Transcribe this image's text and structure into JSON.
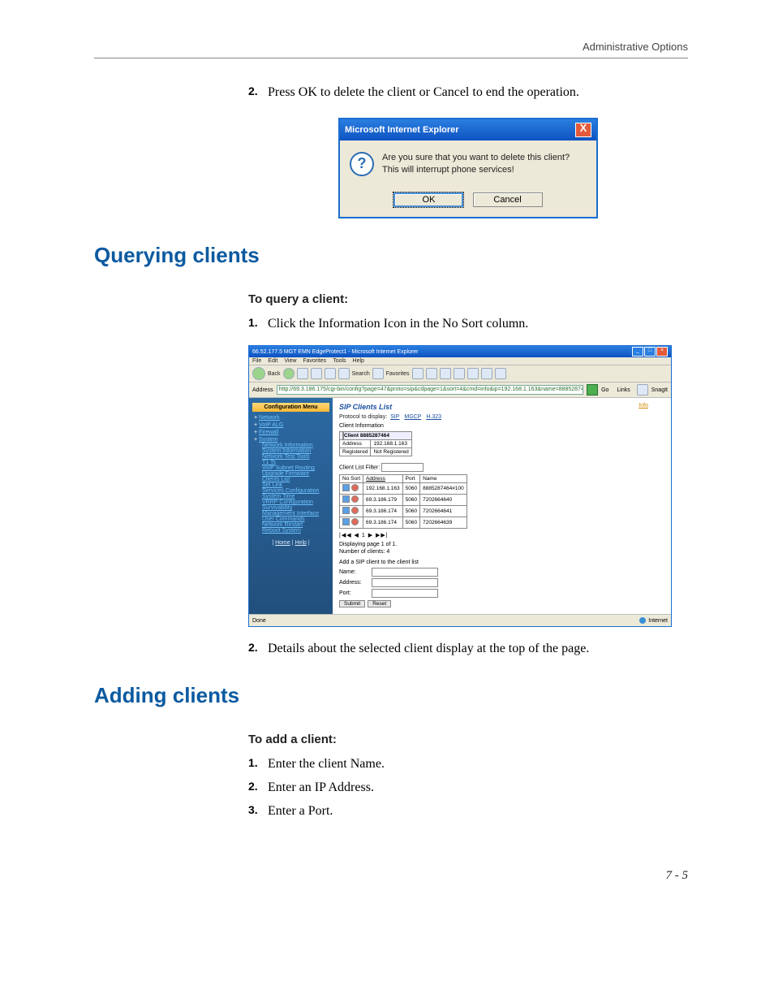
{
  "header": {
    "running": "Administrative Options"
  },
  "step2_top": {
    "num": "2.",
    "text": "Press OK to delete the client or Cancel to end the operation."
  },
  "dialog": {
    "title": "Microsoft Internet Explorer",
    "close": "X",
    "q": "?",
    "line1": "Are you sure that you want to delete this client?",
    "line2": "This will interrupt phone services!",
    "ok": "OK",
    "cancel": "Cancel"
  },
  "sec_query": {
    "title": "Querying clients",
    "sub": "To query a client:"
  },
  "q_step1": {
    "num": "1.",
    "text": "Click the Information Icon in the No Sort column."
  },
  "browser": {
    "title": "66.52.177.5 MGT EMN EdgeProtect1 - Microsoft Internet Explorer",
    "menu": {
      "file": "File",
      "edit": "Edit",
      "view": "View",
      "fav": "Favorites",
      "tools": "Tools",
      "help": "Help"
    },
    "tool": {
      "back": "Back",
      "search": "Search",
      "fav": "Favorites"
    },
    "addr_lbl": "Address",
    "addr_url": "http://69.3.186.175/cgi-bin/config?page=47&proto=sip&cdpage=1&sort=4&cmd=info&ip=192.168.1.163&name=8885287464#100",
    "go": "Go",
    "links": "Links",
    "snag": "SnagIt",
    "side_head": "Configuration Menu",
    "side": {
      "net": "Network",
      "voip": "VoIP ALG",
      "fire": "Firewall",
      "sys": "System",
      "ni": "Network Information",
      "si": "System Information",
      "nt": "Network Test Tools",
      "tos": "T1 Ts",
      "sr": "VoIP Subnet Routing",
      "uf": "Upgrade Firmware",
      "cl": "Clients List",
      "sl": "Set Link",
      "sc": "Services Configuration",
      "st": "System Time",
      "vr": "VRRP Configuration",
      "sv": "Survivability",
      "mi": "Management Interface",
      "uc": "User Commands",
      "nr": "Network Restart",
      "rs": "Reboot System",
      "home": "Home",
      "help": "Help"
    },
    "main": {
      "title": "SIP Clients List",
      "info": "Info",
      "proto_lbl": "Protocol to display:",
      "proto_sip": "SIP",
      "proto_mgcp": "MGCP",
      "proto_h323": "H.323",
      "ci_hdr": "Client Information",
      "ci_name": "Client 8885287464",
      "ci_addr_lbl": "Address",
      "ci_addr": "192.168.1.163",
      "ci_reg_lbl": "Registered",
      "ci_reg": "Not Registered",
      "filter_lbl": "Client List Filter:",
      "cols": {
        "nosort": "No Sort",
        "addr": "Address",
        "port": "Port",
        "name": "Name"
      },
      "rows": [
        {
          "addr": "192.168.1.163",
          "port": "5060",
          "name": "8885287464#100"
        },
        {
          "addr": "69.3.186.179",
          "port": "5060",
          "name": "7202664640"
        },
        {
          "addr": "69.3.186.174",
          "port": "5060",
          "name": "7202664641"
        },
        {
          "addr": "69.3.186.174",
          "port": "5060",
          "name": "7202664639"
        }
      ],
      "pager": "|◀◀ ◀  1   ▶ ▶▶|",
      "disp": "Displaying page 1 of 1.",
      "count": "Number of clients: 4",
      "add_hdr": "Add a SIP client to the client list",
      "name_lbl": "Name:",
      "addr_lbl": "Address:",
      "port_lbl": "Port:",
      "submit": "Submit",
      "reset": "Reset"
    },
    "status": {
      "done": "Done",
      "zone": "Internet"
    }
  },
  "q_step2": {
    "num": "2.",
    "text": "Details about the selected client display at the top of the page."
  },
  "sec_add": {
    "title": "Adding clients",
    "sub": "To add a client:"
  },
  "a_step1": {
    "num": "1.",
    "text": "Enter the client Name."
  },
  "a_step2": {
    "num": "2.",
    "text": "Enter an IP Address."
  },
  "a_step3": {
    "num": "3.",
    "text": "Enter a Port."
  },
  "footer": {
    "page": "7 - 5"
  }
}
